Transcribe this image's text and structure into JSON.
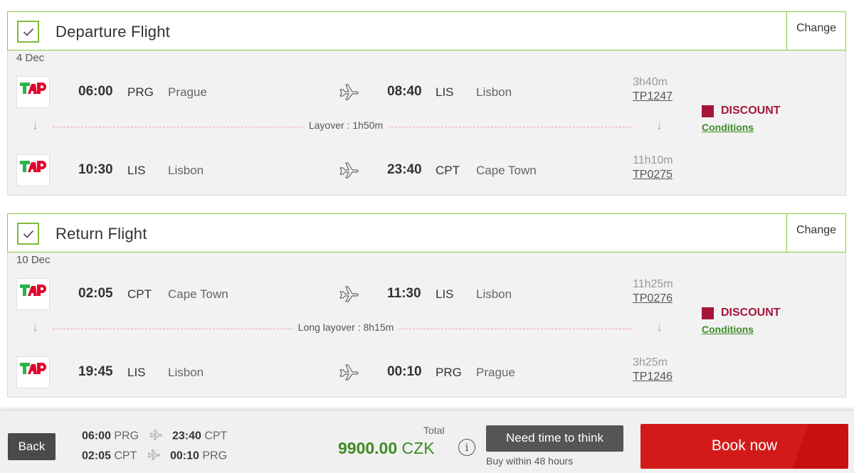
{
  "departure": {
    "title": "Departure Flight",
    "change_label": "Change",
    "date": "4 Dec",
    "segments": [
      {
        "dep_time": "06:00",
        "dep_code": "PRG",
        "dep_city": "Prague",
        "arr_time": "08:40",
        "arr_code": "LIS",
        "arr_city": "Lisbon",
        "duration": "3h40m",
        "flight_no": "TP1247"
      },
      {
        "dep_time": "10:30",
        "dep_code": "LIS",
        "dep_city": "Lisbon",
        "arr_time": "23:40",
        "arr_code": "CPT",
        "arr_city": "Cape Town",
        "duration": "11h10m",
        "flight_no": "TP0275"
      }
    ],
    "layover": "Layover : 1h50m",
    "discount_label": "DISCOUNT",
    "conditions_label": "Conditions"
  },
  "return": {
    "title": "Return Flight",
    "change_label": "Change",
    "date": "10 Dec",
    "segments": [
      {
        "dep_time": "02:05",
        "dep_code": "CPT",
        "dep_city": "Cape Town",
        "arr_time": "11:30",
        "arr_code": "LIS",
        "arr_city": "Lisbon",
        "duration": "11h25m",
        "flight_no": "TP0276"
      },
      {
        "dep_time": "19:45",
        "dep_code": "LIS",
        "dep_city": "Lisbon",
        "arr_time": "00:10",
        "arr_code": "PRG",
        "arr_city": "Prague",
        "duration": "3h25m",
        "flight_no": "TP1246"
      }
    ],
    "layover": "Long layover : 8h15m",
    "discount_label": "DISCOUNT",
    "conditions_label": "Conditions"
  },
  "footer": {
    "back_label": "Back",
    "summary": [
      {
        "dep_time": "06:00",
        "dep_code": "PRG",
        "arr_time": "23:40",
        "arr_code": "CPT"
      },
      {
        "dep_time": "02:05",
        "dep_code": "CPT",
        "arr_time": "00:10",
        "arr_code": "PRG"
      }
    ],
    "total_label": "Total",
    "total_amount": "9900.00",
    "total_currency": "CZK",
    "info_glyph": "i",
    "think_label": "Need time to think",
    "think_sub": "Buy within 48 hours",
    "book_label": "Book now"
  },
  "icons": {
    "check": "check-icon",
    "plane": "plane-icon",
    "arrow_down": "arrow-down-icon",
    "info": "info-icon",
    "airline_logo": "tap-logo"
  },
  "colors": {
    "accent_green": "#8cc63f",
    "price_green": "#3e8b24",
    "discount_red": "#a3163a",
    "book_red": "#d31a1a"
  }
}
